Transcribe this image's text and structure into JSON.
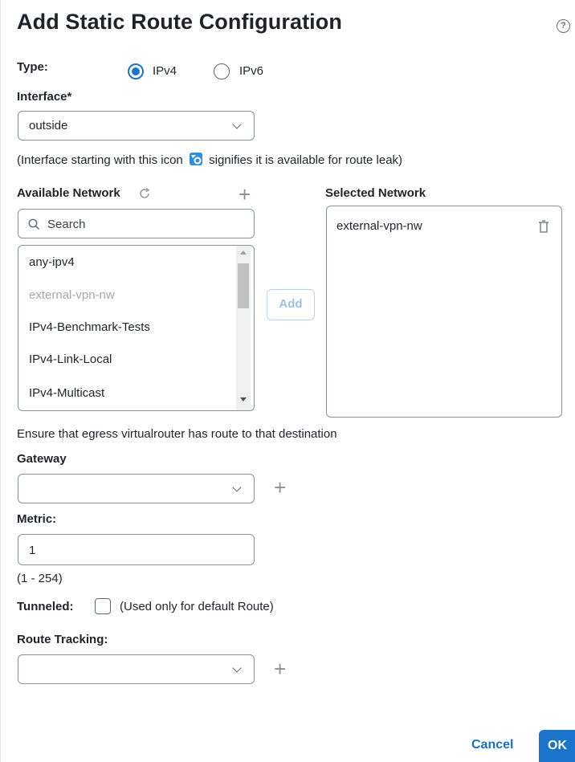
{
  "dialog": {
    "title": "Add Static Route Configuration",
    "help_glyph": "?"
  },
  "type": {
    "label": "Type:",
    "options": [
      "IPv4",
      "IPv6"
    ],
    "selected": "IPv4"
  },
  "interface": {
    "label": "Interface*",
    "value": "outside",
    "note_before": "(Interface starting with this icon",
    "note_after": "signifies it is available for route leak)"
  },
  "available_network": {
    "label": "Available Network",
    "search_placeholder": "Search",
    "items": [
      {
        "label": "any-ipv4",
        "disabled": false
      },
      {
        "label": "external-vpn-nw",
        "disabled": true
      },
      {
        "label": "IPv4-Benchmark-Tests",
        "disabled": false
      },
      {
        "label": "IPv4-Link-Local",
        "disabled": false
      },
      {
        "label": "IPv4-Multicast",
        "disabled": false
      }
    ]
  },
  "add_button": {
    "label": "Add"
  },
  "selected_network": {
    "label": "Selected Network",
    "items": [
      {
        "label": "external-vpn-nw"
      }
    ]
  },
  "egress_note": "Ensure that egress virtualrouter has route to that destination",
  "gateway": {
    "label": "Gateway",
    "value": ""
  },
  "metric": {
    "label": "Metric:",
    "value": "1",
    "range": "(1 - 254)"
  },
  "tunneled": {
    "label": "Tunneled:",
    "note": "(Used only for default Route)",
    "checked": false
  },
  "route_tracking": {
    "label": "Route Tracking:",
    "value": ""
  },
  "footer": {
    "cancel_label": "Cancel",
    "ok_label": "OK"
  },
  "colors": {
    "accent": "#1b74cc",
    "disabled_text": "#a3a8ae"
  },
  "icons": [
    "help-icon",
    "refresh-icon",
    "plus-icon",
    "search-icon",
    "chevron-down-icon",
    "trash-icon",
    "route-leak-icon"
  ]
}
